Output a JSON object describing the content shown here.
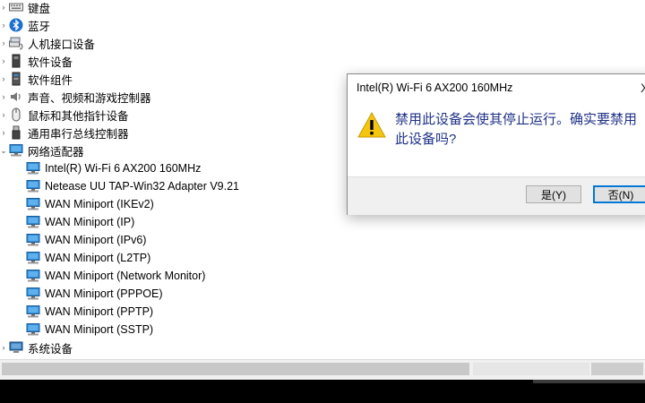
{
  "tree": {
    "items": [
      {
        "label": "键盘",
        "icon": "keyboard-icon",
        "level": 0,
        "expander": "collapsed"
      },
      {
        "label": "蓝牙",
        "icon": "bluetooth-icon",
        "level": 0,
        "expander": "collapsed"
      },
      {
        "label": "人机接口设备",
        "icon": "hid-icon",
        "level": 0,
        "expander": "collapsed"
      },
      {
        "label": "软件设备",
        "icon": "software-device-icon",
        "level": 0,
        "expander": "collapsed"
      },
      {
        "label": "软件组件",
        "icon": "software-component-icon",
        "level": 0,
        "expander": "collapsed"
      },
      {
        "label": "声音、视频和游戏控制器",
        "icon": "audio-icon",
        "level": 0,
        "expander": "collapsed"
      },
      {
        "label": "鼠标和其他指针设备",
        "icon": "mouse-icon",
        "level": 0,
        "expander": "collapsed"
      },
      {
        "label": "通用串行总线控制器",
        "icon": "usb-icon",
        "level": 0,
        "expander": "collapsed"
      },
      {
        "label": "网络适配器",
        "icon": "network-adapter-icon",
        "level": 0,
        "expander": "expanded"
      },
      {
        "label": "Intel(R) Wi-Fi 6 AX200 160MHz",
        "icon": "network-adapter-icon",
        "level": 1
      },
      {
        "label": "Netease UU TAP-Win32 Adapter V9.21",
        "icon": "network-adapter-icon",
        "level": 1
      },
      {
        "label": "WAN Miniport (IKEv2)",
        "icon": "network-adapter-icon",
        "level": 1
      },
      {
        "label": "WAN Miniport (IP)",
        "icon": "network-adapter-icon",
        "level": 1
      },
      {
        "label": "WAN Miniport (IPv6)",
        "icon": "network-adapter-icon",
        "level": 1
      },
      {
        "label": "WAN Miniport (L2TP)",
        "icon": "network-adapter-icon",
        "level": 1
      },
      {
        "label": "WAN Miniport (Network Monitor)",
        "icon": "network-adapter-icon",
        "level": 1
      },
      {
        "label": "WAN Miniport (PPPOE)",
        "icon": "network-adapter-icon",
        "level": 1
      },
      {
        "label": "WAN Miniport (PPTP)",
        "icon": "network-adapter-icon",
        "level": 1
      },
      {
        "label": "WAN Miniport (SSTP)",
        "icon": "network-adapter-icon",
        "level": 1
      },
      {
        "label": "系统设备",
        "icon": "system-device-icon",
        "level": 0,
        "expander": "collapsed"
      }
    ]
  },
  "dialog": {
    "title": "Intel(R) Wi-Fi 6 AX200 160MHz",
    "close_glyph": "X",
    "message_line1": "禁用此设备会使其停止运行。确实要禁用",
    "message_line2": "此设备吗?",
    "yes_label": "是(Y)",
    "no_label": "否(N)",
    "icon": "warning-icon"
  },
  "colors": {
    "message_text": "#1e3287",
    "default_button_border": "#0078d7",
    "adapter_icon": "#2e8bd6"
  }
}
